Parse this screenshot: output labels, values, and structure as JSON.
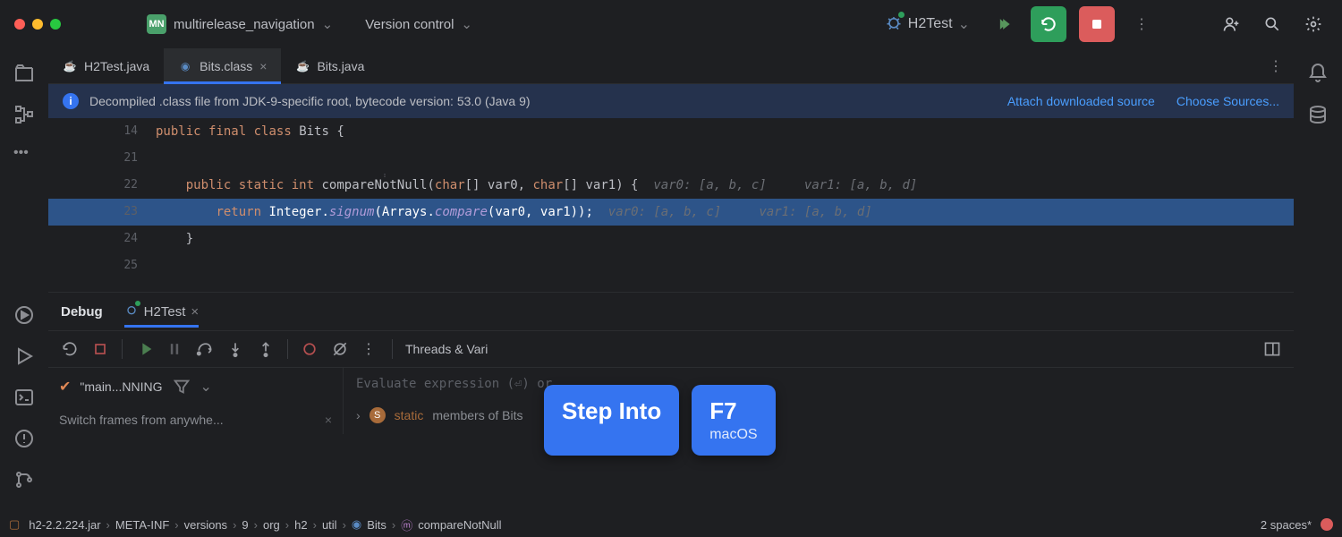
{
  "titlebar": {
    "project_badge": "MN",
    "project_name": "multirelease_navigation",
    "menu_vcs": "Version control",
    "run_config": "H2Test"
  },
  "tabs": {
    "items": [
      {
        "label": "H2Test.java",
        "icon": "java-file-icon",
        "active": false
      },
      {
        "label": "Bits.class",
        "icon": "class-file-icon",
        "active": true,
        "closeable": true
      },
      {
        "label": "Bits.java",
        "icon": "java-file-icon",
        "active": false
      }
    ]
  },
  "banner": {
    "text": "Decompiled .class file from JDK-9-specific root, bytecode version: 53.0 (Java 9)",
    "attach": "Attach downloaded source",
    "choose": "Choose Sources..."
  },
  "code": {
    "lines": [
      {
        "n": "14",
        "html": "public final class Bits {"
      },
      {
        "n": "21",
        "html": ""
      },
      {
        "n": "22",
        "html": "    public static int compareNotNull(char[] var0, char[] var1) {",
        "hint": "  var0: [a, b, c]     var1: [a, b, d]"
      },
      {
        "n": "23",
        "html": "        return Integer.signum(Arrays.compare(var0, var1));",
        "hint": "  var0: [a, b, c]     var1: [a, b, d]",
        "exec": true
      },
      {
        "n": "24",
        "html": "    }"
      },
      {
        "n": "25",
        "html": ""
      }
    ]
  },
  "debug": {
    "tab_debug": "Debug",
    "tab_session": "H2Test",
    "threads_label": "Threads & Vari",
    "frame_status": "\"main...NNING",
    "switch_hint": "Switch frames from anywhe...",
    "eval_placeholder": "Evaluate expression (⏎) or",
    "members_static": "static",
    "members_text": "members of Bits"
  },
  "tooltip": {
    "action": "Step Into",
    "key": "F7",
    "platform": "macOS"
  },
  "breadcrumb": {
    "items": [
      "h2-2.2.224.jar",
      "META-INF",
      "versions",
      "9",
      "org",
      "h2",
      "util",
      "Bits",
      "compareNotNull"
    ]
  },
  "status": {
    "indent": "2 spaces*"
  }
}
